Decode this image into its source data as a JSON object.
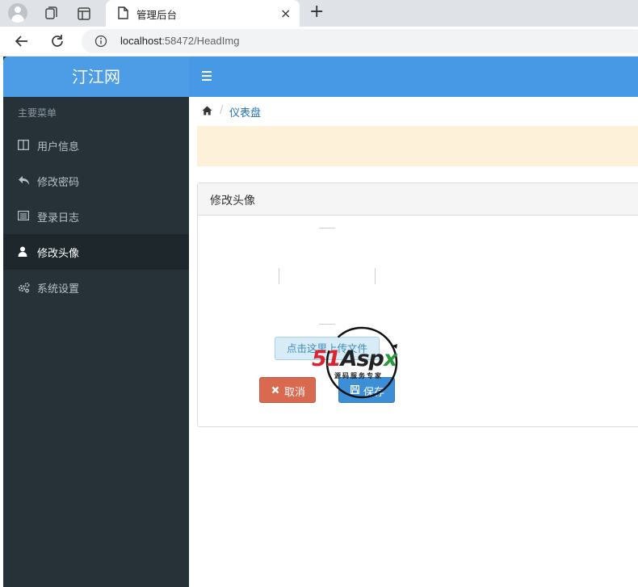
{
  "browser": {
    "tab_title": "管理后台",
    "tab_close": "×",
    "new_tab": "+",
    "url_host": "localhost",
    "url_rest": ":58472/HeadImg"
  },
  "sidebar": {
    "brand": "汀江网",
    "menu_header": "主要菜单",
    "items": [
      {
        "label": "用户信息",
        "icon": "columns-icon"
      },
      {
        "label": "修改密码",
        "icon": "reply-icon"
      },
      {
        "label": "登录日志",
        "icon": "list-icon"
      },
      {
        "label": "修改头像",
        "icon": "user-icon",
        "active": true
      },
      {
        "label": "系统设置",
        "icon": "cogs-icon"
      }
    ]
  },
  "breadcrumb": {
    "separator": "/",
    "current": "仪表盘"
  },
  "panel": {
    "title": "修改头像",
    "upload_label": "点击这里上传文件",
    "cancel_label": "取消",
    "save_label": "保存"
  },
  "watermark": {
    "brand_a": "51",
    "brand_b": "Asp",
    "brand_c": "x",
    "subtitle": "源码服务专家"
  },
  "colors": {
    "sidebar_bg": "#263238",
    "brand_bg": "#4c9ce6",
    "topbar_bg": "#4799e5",
    "alert_bg": "#fdf1da",
    "cancel_bg": "#d9694f",
    "save_bg": "#3c8fd6"
  }
}
